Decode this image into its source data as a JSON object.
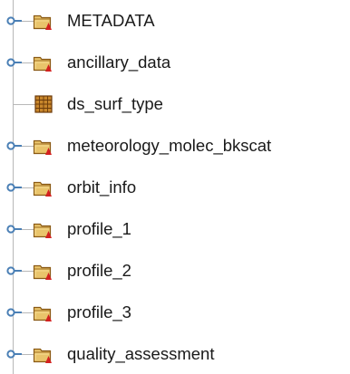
{
  "tree": {
    "items": [
      {
        "label": "METADATA",
        "kind": "group",
        "icon": "group-folder-icon",
        "expandable": true
      },
      {
        "label": "ancillary_data",
        "kind": "group",
        "icon": "group-folder-icon",
        "expandable": true
      },
      {
        "label": "ds_surf_type",
        "kind": "dataset",
        "icon": "dataset-grid-icon",
        "expandable": false
      },
      {
        "label": "meteorology_molec_bkscat",
        "kind": "group",
        "icon": "group-folder-icon",
        "expandable": true
      },
      {
        "label": "orbit_info",
        "kind": "group",
        "icon": "group-folder-icon",
        "expandable": true
      },
      {
        "label": "profile_1",
        "kind": "group",
        "icon": "group-folder-icon",
        "expandable": true
      },
      {
        "label": "profile_2",
        "kind": "group",
        "icon": "group-folder-icon",
        "expandable": true
      },
      {
        "label": "profile_3",
        "kind": "group",
        "icon": "group-folder-icon",
        "expandable": true
      },
      {
        "label": "quality_assessment",
        "kind": "group",
        "icon": "group-folder-icon",
        "expandable": true
      }
    ]
  },
  "colors": {
    "tree_line": "#b8b8b8",
    "handle": "#4a7fb5",
    "folder_fill": "#e9c46b",
    "folder_edge": "#8a5a14",
    "folder_badge": "#d42020",
    "dataset_fill": "#c8862b",
    "dataset_edge": "#6b3a0a",
    "text": "#1a1a1a"
  }
}
